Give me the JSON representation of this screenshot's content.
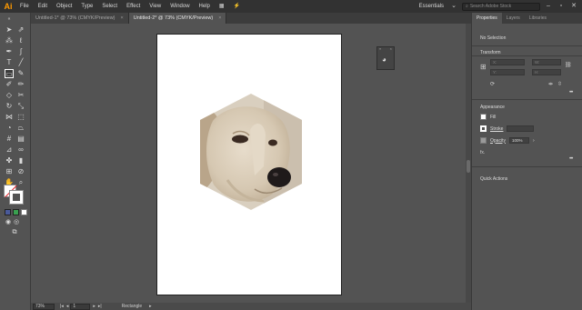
{
  "app": {
    "logo": "Ai"
  },
  "menu": [
    "File",
    "Edit",
    "Object",
    "Type",
    "Select",
    "Effect",
    "View",
    "Window",
    "Help"
  ],
  "menubar_right": {
    "workspace": "Essentials",
    "search_placeholder": "Search Adobe Stock"
  },
  "tabs": [
    {
      "label": "Untitled-1* @ 73% (CMYK/Preview)",
      "active": false
    },
    {
      "label": "Untitled-2* @ 73% (CMYK/Preview)",
      "active": true
    }
  ],
  "status": {
    "zoom": "73%",
    "artboard": "1",
    "tool": "Rectangle"
  },
  "properties": {
    "tabs": [
      "Properties",
      "Layers",
      "Libraries"
    ],
    "selection": "No Selection",
    "transform": {
      "title": "Transform",
      "x_label": "X:",
      "y_label": "Y:",
      "w_label": "W:",
      "h_label": "H:"
    },
    "appearance": {
      "title": "Appearance",
      "fill": "Fill",
      "stroke": "Stroke",
      "opacity": "Opacity",
      "opacity_value": "100%",
      "fx": "fx."
    },
    "quick_actions": "Quick Actions"
  },
  "colors": {
    "accent": "#ff9a00",
    "no_color": "#e0242a"
  },
  "icons": [
    "selection-icon",
    "direct-selection-icon",
    "magic-wand-icon",
    "lasso-icon",
    "pen-icon",
    "curvature-icon",
    "type-icon",
    "line-icon",
    "rectangle-icon",
    "paintbrush-icon",
    "shaper-icon",
    "pencil-icon",
    "eraser-icon",
    "rotate-icon",
    "scale-icon",
    "width-icon",
    "free-transform-icon",
    "shape-builder-icon",
    "perspective-icon",
    "mesh-icon",
    "gradient-icon",
    "eyedropper-icon",
    "blend-icon",
    "symbol-sprayer-icon",
    "graph-icon",
    "artboard-icon",
    "slice-icon",
    "hand-icon",
    "zoom-icon"
  ]
}
